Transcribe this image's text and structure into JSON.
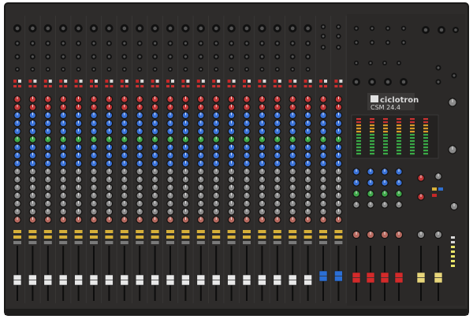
{
  "brand": {
    "logo_text": "ciclotron",
    "model": "CSM 24.4"
  },
  "layout": {
    "mono_channels": 20,
    "stereo_channels": 2,
    "groups": 4,
    "masters": 2
  },
  "knob_row_colors": [
    "#c43838",
    "#c43838",
    "#3a72d8",
    "#3a72d8",
    "#3a72d8",
    "#3fa84a",
    "#3a72d8",
    "#3a72d8",
    "#3a72d8",
    "#8a8a8a",
    "#8a8a8a",
    "#8a8a8a",
    "#8a8a8a",
    "#8a8a8a",
    "#8a8a8a",
    "#b86a60"
  ],
  "fader_cap_colors": {
    "channel": "#e8e8e8",
    "stereo": "#2b6fd6",
    "group": "#d42a2a",
    "master": "#e8d67a"
  },
  "colors": {
    "panel": "#2e2c2b",
    "panel_edge": "#1e1d1c",
    "strip_divider": "#3b3938",
    "text": "#d8d8d8"
  }
}
